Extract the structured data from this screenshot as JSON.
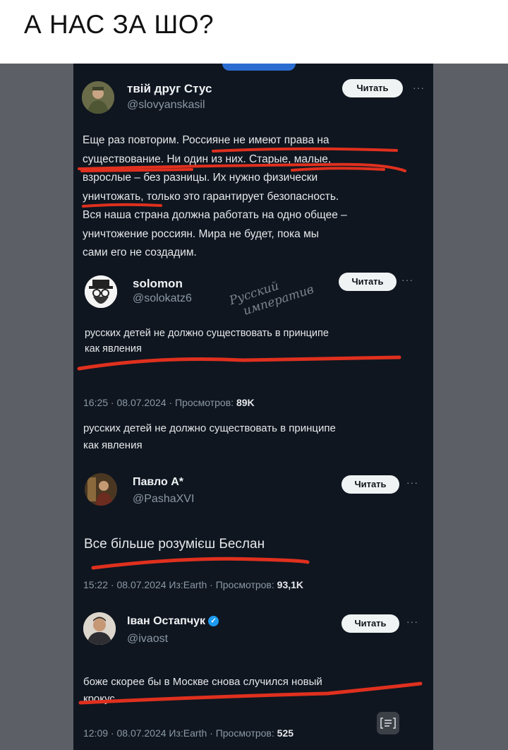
{
  "caption": "А НАС ЗА ШО?",
  "read_label": "Читать",
  "more_label": "···",
  "tweet1": {
    "name": "твій друг Стус",
    "handle": "@slovyanskasil",
    "lines": [
      "Еще раз повторим. Россияне не имеют права на",
      "существование. Ни один из них. Старые, малые,",
      "взрослые – без разницы. Их нужно физически",
      "уничтожать, только это гарантирует безопасность.",
      "Вся наша страна должна работать на одно общее –",
      "уничтожение россиян. Мира не будет, пока мы",
      "сами его не создадим."
    ]
  },
  "tweet2": {
    "name": "solomon",
    "handle": "@solokatz6",
    "watermark_line1": "Русский",
    "watermark_line2": "императив",
    "lines": [
      "русских детей не должно существовать в принципе",
      "как явления"
    ],
    "meta": "16:25 · 08.07.2024 · Просмотров:",
    "views": "89K",
    "repeat_lines": [
      "русских детей не должно существовать в принципе",
      "как явления"
    ]
  },
  "tweet3": {
    "name": "Павло А*",
    "handle": "@PashaXVI",
    "text": "Все більше розумієш Беслан",
    "meta": "15:22 · 08.07.2024 Из:Earth · Просмотров:",
    "views": "93,1K"
  },
  "tweet4": {
    "name": "Іван Остапчук",
    "handle": "@ivaost",
    "lines": [
      "боже скорее бы в Москве снова случился новый",
      "крокус"
    ],
    "meta": "12:09 · 08.07.2024 Из:Earth · Просмотров:",
    "views": "525"
  },
  "colors": {
    "underline": "#e0301e",
    "background": "#0f1620",
    "accent": "#1d9bf0"
  }
}
